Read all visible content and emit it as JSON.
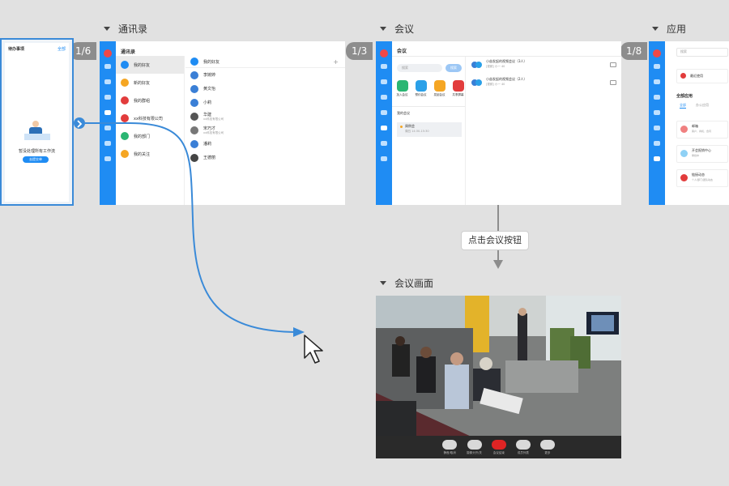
{
  "sections": {
    "contacts": "通讯录",
    "meeting": "会议",
    "apps": "应用",
    "meeting_screen": "会议画面"
  },
  "badges": {
    "contacts": "1/6",
    "meeting": "1/3",
    "apps": "1/8"
  },
  "callout": "点击会议按钮",
  "colors": {
    "accent": "#1f8cf3",
    "highlight_border": "#3a8ad8",
    "arrow": "#3a8ad8",
    "end_call": "#e02424"
  },
  "icons": [
    "chevron-down-icon",
    "chevron-right-icon",
    "mouse-pointer-icon",
    "phone-icon",
    "mic-icon"
  ],
  "todo_panel": {
    "title": "待办事项",
    "link": "全部",
    "empty_text": "暂没处理所有工作流",
    "button": "去提交单"
  },
  "contacts_frame": {
    "title": "通讯录",
    "groups": [
      "我的好友",
      "新的好友",
      "我的群组",
      "xx科技有限公司",
      "我的部门",
      "我的关注"
    ],
    "panel_title": "我的好友",
    "people": [
      {
        "name": "李婉婷",
        "sub": ""
      },
      {
        "name": "黄文怡",
        "sub": ""
      },
      {
        "name": "小莉",
        "sub": ""
      },
      {
        "name": "华建",
        "sub": "xx科技有限公司"
      },
      {
        "name": "宋巧才",
        "sub": "xx科技有限公司"
      },
      {
        "name": "潘莉",
        "sub": ""
      },
      {
        "name": "王德丽",
        "sub": ""
      }
    ]
  },
  "meeting_frame": {
    "title": "会议",
    "search_placeholder": "搜索",
    "search_button": "搜索",
    "actions": [
      "加入会议",
      "预约会议",
      "发起会议",
      "共享屏幕"
    ],
    "my_meetings_label": "我的会议",
    "meeting_item_title": "周例会",
    "meeting_item_time": "周四 14:30-15:30",
    "right_items": [
      {
        "title": "小苗发起的视频会议（3人）",
        "sub": "[视频] 小一 40"
      },
      {
        "title": "小苗发起的视频会议（2人）",
        "sub": "[视频] 小一 40"
      }
    ]
  },
  "apps_frame": {
    "search_placeholder": "搜索",
    "recent": "最近使用",
    "all_apps": "全部应用",
    "tabs": [
      "全部",
      "办公应用"
    ],
    "items": [
      {
        "title": "邮箱",
        "sub": "客户、商机、合同"
      },
      {
        "title": "开会报销中心",
        "sub": "审批中"
      },
      {
        "title": "链接动态",
        "sub": "个人/部门/团队动态"
      }
    ]
  },
  "call_controls": [
    "静音/取消",
    "摄像头开/关",
    "会议结束",
    "成员列表",
    "更多"
  ]
}
